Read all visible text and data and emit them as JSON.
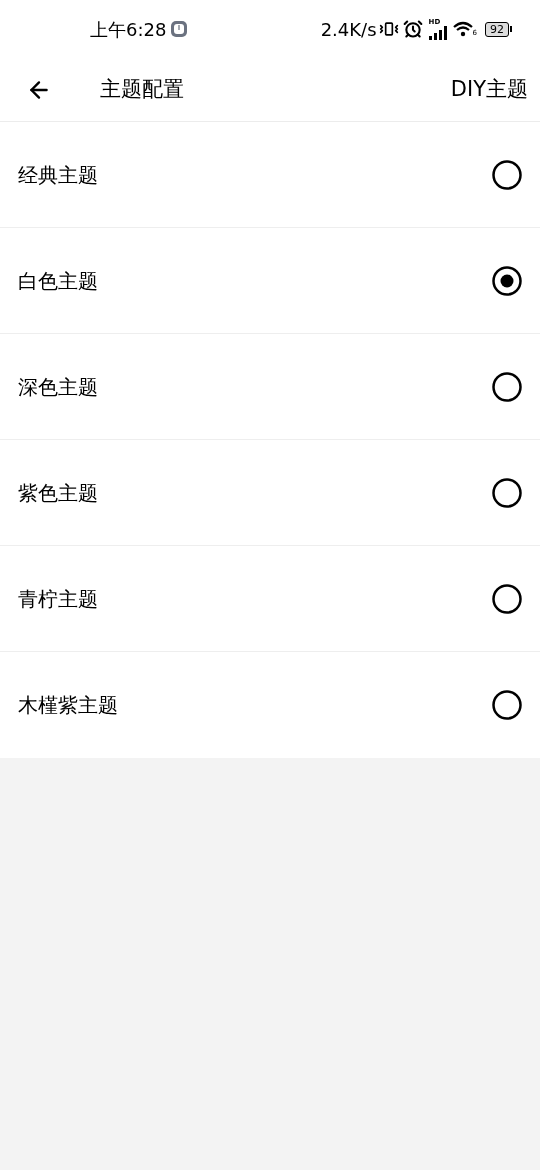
{
  "status_bar": {
    "time": "上午6:28",
    "net_speed": "2.4K/s",
    "signal_label": "HD",
    "wifi_label": "6",
    "battery": "92"
  },
  "header": {
    "title": "主题配置",
    "action": "DIY主题"
  },
  "themes": [
    {
      "label": "经典主题",
      "selected": false
    },
    {
      "label": "白色主题",
      "selected": true
    },
    {
      "label": "深色主题",
      "selected": false
    },
    {
      "label": "紫色主题",
      "selected": false
    },
    {
      "label": "青柠主题",
      "selected": false
    },
    {
      "label": "木槿紫主题",
      "selected": false
    }
  ]
}
